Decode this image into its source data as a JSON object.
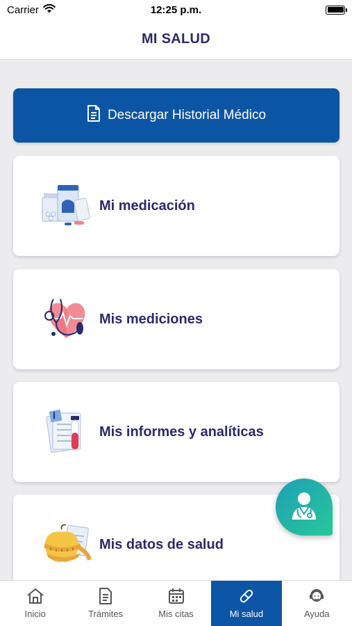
{
  "status_bar": {
    "carrier": "Carrier",
    "time": "12:25 p.m."
  },
  "header": {
    "title": "MI SALUD"
  },
  "download_button": {
    "label": "Descargar Historial Médico"
  },
  "cards": [
    {
      "label": "Mi medicación",
      "icon": "medication-illustration"
    },
    {
      "label": "Mis mediciones",
      "icon": "heart-stethoscope-illustration"
    },
    {
      "label": "Mis informes y analíticas",
      "icon": "reports-test-tube-illustration"
    },
    {
      "label": "Mis datos de salud",
      "icon": "apple-measuring-tape-illustration"
    }
  ],
  "fab": {
    "icon": "doctor-icon"
  },
  "tabbar": {
    "items": [
      {
        "label": "Inicio",
        "icon": "home-icon",
        "active": false
      },
      {
        "label": "Trámites",
        "icon": "document-icon",
        "active": false
      },
      {
        "label": "Mis citas",
        "icon": "calendar-icon",
        "active": false
      },
      {
        "label": "Mi salud",
        "icon": "pill-icon",
        "active": true
      },
      {
        "label": "Ayuda",
        "icon": "support-agent-icon",
        "active": false
      }
    ]
  },
  "colors": {
    "primary": "#0c55a4",
    "title_text": "#2b2a6b",
    "background": "#ececef",
    "fab_gradient_start": "#1f9fb5",
    "fab_gradient_end": "#27c79a"
  }
}
